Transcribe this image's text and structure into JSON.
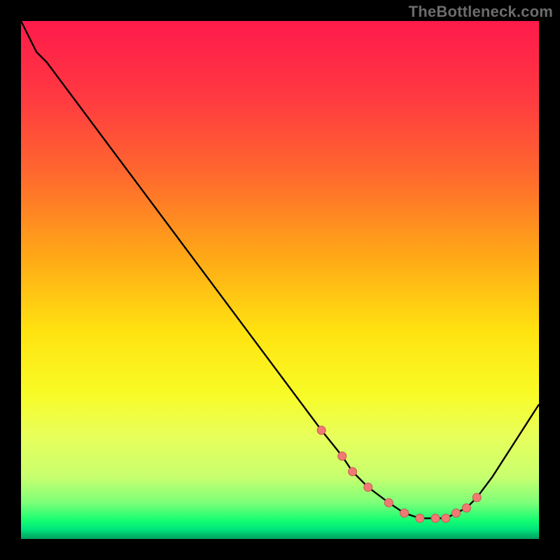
{
  "watermark": "TheBottleneck.com",
  "colors": {
    "frame": "#000000",
    "watermark": "#6c6c6c",
    "gradient_stops": [
      {
        "offset": 0.0,
        "color": "#ff1a4b"
      },
      {
        "offset": 0.15,
        "color": "#ff3a41"
      },
      {
        "offset": 0.3,
        "color": "#ff6a2d"
      },
      {
        "offset": 0.45,
        "color": "#ffa617"
      },
      {
        "offset": 0.6,
        "color": "#ffe310"
      },
      {
        "offset": 0.72,
        "color": "#f8fb26"
      },
      {
        "offset": 0.8,
        "color": "#e8ff5a"
      },
      {
        "offset": 0.88,
        "color": "#c8ff6e"
      },
      {
        "offset": 0.93,
        "color": "#7dff79"
      },
      {
        "offset": 0.965,
        "color": "#13fd72"
      },
      {
        "offset": 0.982,
        "color": "#00e37c"
      },
      {
        "offset": 1.0,
        "color": "#009e5d"
      }
    ],
    "curve": "#000000",
    "markers_fill": "#f07a73",
    "markers_stroke": "#c45b55"
  },
  "chart_data": {
    "type": "line",
    "title": "",
    "xlabel": "",
    "ylabel": "",
    "xlim": [
      0,
      100
    ],
    "ylim": [
      0,
      100
    ],
    "series": [
      {
        "name": "bottleneck-curve",
        "x": [
          0,
          3,
          5,
          58,
          62,
          64,
          67,
          71,
          74,
          77,
          80,
          82,
          84,
          86,
          88,
          91,
          100
        ],
        "values": [
          100,
          94,
          92,
          21,
          16,
          13,
          10,
          7,
          5,
          4,
          4,
          4,
          5,
          6,
          8,
          12,
          26
        ]
      }
    ],
    "markers": {
      "name": "highlight-range",
      "x": [
        58,
        62,
        64,
        67,
        71,
        74,
        77,
        80,
        82,
        84,
        86,
        88
      ],
      "values": [
        21,
        16,
        13,
        10,
        7,
        5,
        4,
        4,
        4,
        5,
        6,
        8
      ]
    }
  }
}
